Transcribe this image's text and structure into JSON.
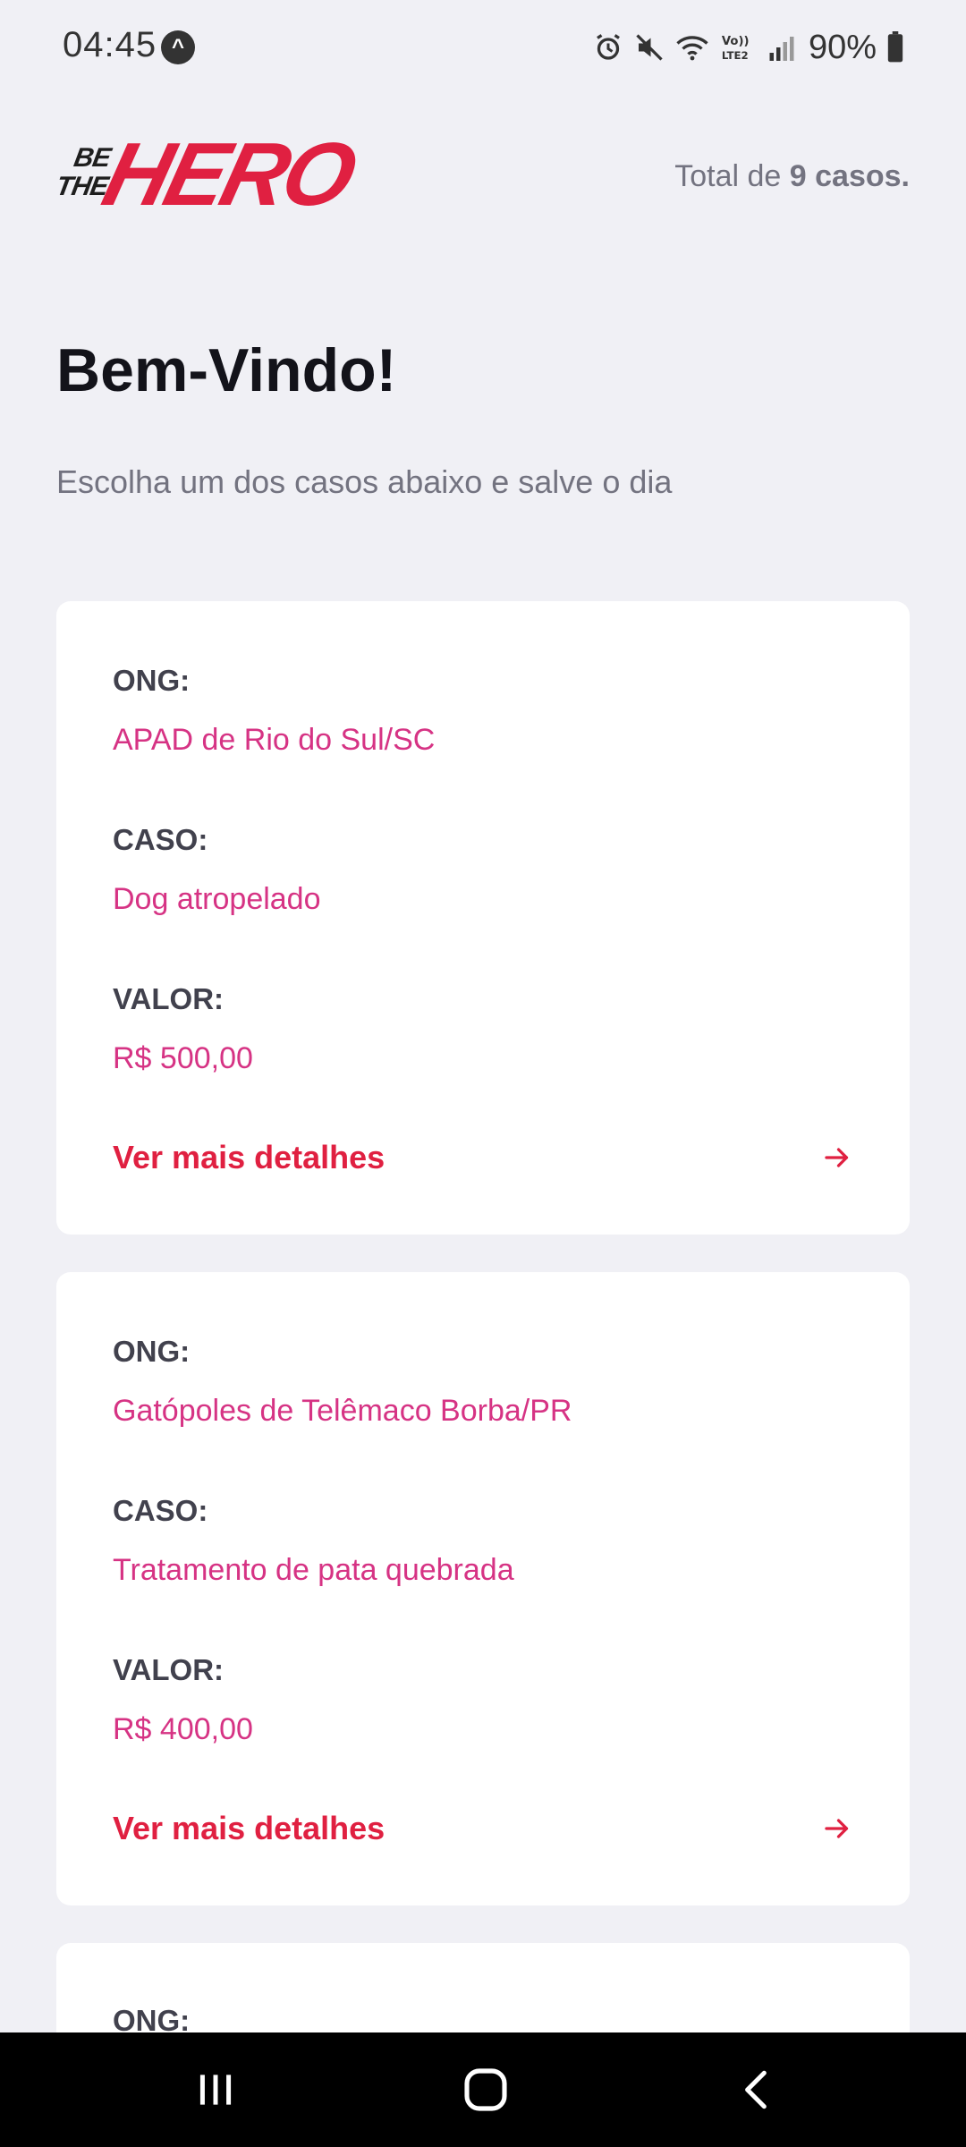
{
  "status_bar": {
    "time": "04:45",
    "app_icon_letter": "",
    "battery_text": "90%"
  },
  "header": {
    "logo_be": "BE",
    "logo_the": "THE",
    "logo_hero": "HERO",
    "total_prefix": "Total de",
    "total_count": "9 casos."
  },
  "intro": {
    "title": "Bem-Vindo!",
    "subtitle": "Escolha um dos casos abaixo e salve o dia"
  },
  "cards": [
    {
      "ong_label": "ONG:",
      "ong_value": "APAD de Rio do Sul/SC",
      "case_label": "CASO:",
      "case_value": "Dog atropelado",
      "value_label": "VALOR:",
      "value_value": "R$ 500,00",
      "link_label": "Ver mais detalhes"
    },
    {
      "ong_label": "ONG:",
      "ong_value": "Gatópoles de Telêmaco Borba/PR",
      "case_label": "CASO:",
      "case_value": "Tratamento de pata quebrada",
      "value_label": "VALOR:",
      "value_value": "R$ 400,00",
      "link_label": "Ver mais detalhes"
    },
    {
      "ong_label": "ONG:"
    }
  ],
  "colors": {
    "accent": "#e02041",
    "value_pink": "#d63384",
    "background": "#f0f0f5"
  }
}
